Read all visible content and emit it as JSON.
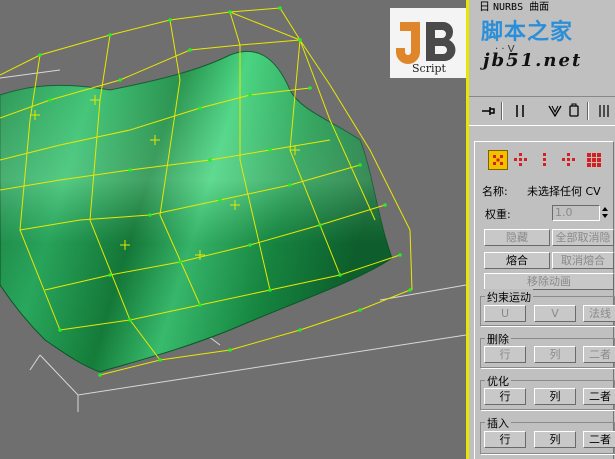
{
  "rollout": {
    "title": "NURBS 曲面",
    "collapse_symbol": "日",
    "subtitle": "·  ·  V"
  },
  "watermark": {
    "logo_letters": "JB",
    "logo_caption": "Script",
    "site_name": "脚本之家",
    "site_url": "jb51.net"
  },
  "selection": {
    "icons": [
      "cv-single-icon",
      "cv-row-icon",
      "cv-column-icon",
      "cv-cross-icon",
      "cv-all-icon"
    ],
    "name_label": "名称:",
    "name_value": "未选择任何 CV",
    "weight_label": "权重:",
    "weight_value": "1.0",
    "hide_label": "隐藏",
    "unhide_all_label": "全部取消隐",
    "fuse_label": "熔合",
    "unfuse_label": "取消熔合",
    "remove_anim_label": "移除动画"
  },
  "constrained_motion": {
    "title": "约束运动",
    "u_label": "U",
    "v_label": "V",
    "normal_label": "法线"
  },
  "delete": {
    "title": "删除",
    "row_label": "行",
    "col_label": "列",
    "both_label": "二者"
  },
  "refine": {
    "title": "优化",
    "row_label": "行",
    "col_label": "列",
    "both_label": "二者"
  },
  "insert": {
    "title": "插入",
    "row_label": "行",
    "col_label": "列",
    "both_label": "二者"
  },
  "colors": {
    "surface": "#1faa55",
    "cage": "#e8e800",
    "cv_point": "#22ee22",
    "panel": "#c0c0c0",
    "active_icon_bg": "#f2c200",
    "icon_red": "#d42020"
  }
}
